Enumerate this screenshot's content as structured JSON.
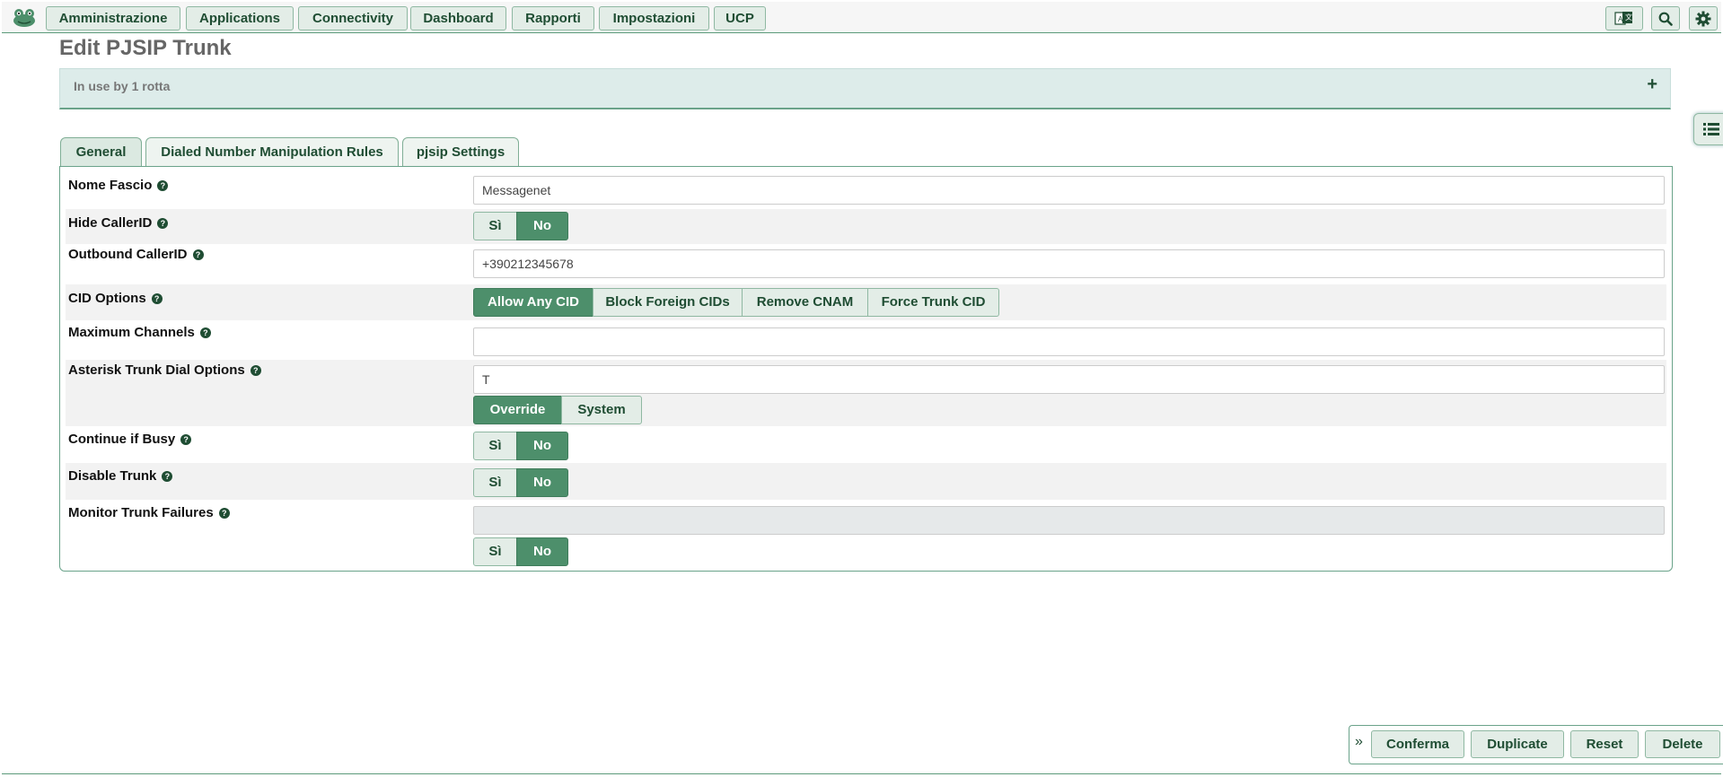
{
  "nav": {
    "items": [
      "Amministrazione",
      "Applications",
      "Connectivity",
      "Dashboard",
      "Rapporti",
      "Impostazioni",
      "UCP"
    ]
  },
  "page": {
    "title": "Edit PJSIP Trunk",
    "in_use": "In use by 1 rotta"
  },
  "tabs": [
    "General",
    "Dialed Number Manipulation Rules",
    "pjsip Settings"
  ],
  "form": {
    "trunk_name": {
      "label": "Nome Fascio",
      "value": "Messagenet"
    },
    "hide_callerid": {
      "label": "Hide CallerID",
      "options": [
        "Sì",
        "No"
      ],
      "selected": "No"
    },
    "outbound_callerid": {
      "label": "Outbound CallerID",
      "value": "+390212345678"
    },
    "cid_options": {
      "label": "CID Options",
      "options": [
        "Allow Any CID",
        "Block Foreign CIDs",
        "Remove CNAM",
        "Force Trunk CID"
      ],
      "selected": "Allow Any CID"
    },
    "max_channels": {
      "label": "Maximum Channels",
      "value": ""
    },
    "dial_options": {
      "label": "Asterisk Trunk Dial Options",
      "value": "T",
      "options": [
        "Override",
        "System"
      ],
      "selected": "Override"
    },
    "continue_busy": {
      "label": "Continue if Busy",
      "options": [
        "Sì",
        "No"
      ],
      "selected": "No"
    },
    "disable_trunk": {
      "label": "Disable Trunk",
      "options": [
        "Sì",
        "No"
      ],
      "selected": "No"
    },
    "monitor_failures": {
      "label": "Monitor Trunk Failures",
      "value": "",
      "options": [
        "Sì",
        "No"
      ],
      "selected": "No"
    }
  },
  "actions": {
    "submit": "Conferma",
    "duplicate": "Duplicate",
    "reset": "Reset",
    "delete": "Delete"
  },
  "colors": {
    "accent": "#4d8f6b",
    "button_bg": "#e3ede7",
    "text_dark": "#1f4d33"
  }
}
